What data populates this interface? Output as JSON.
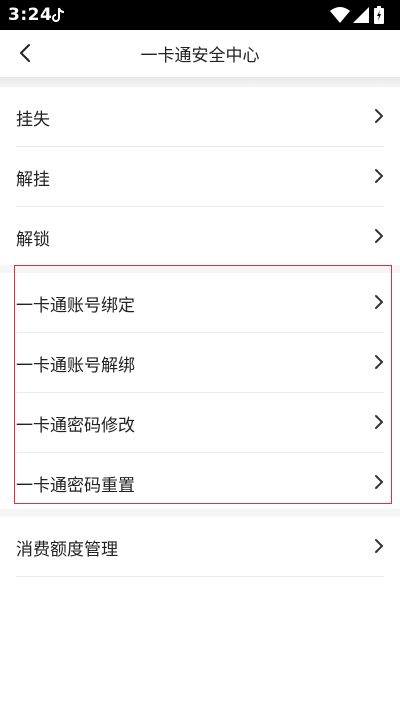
{
  "status_bar": {
    "time": "3:24",
    "icons": [
      "tiktok-icon",
      "wifi-icon",
      "signal-icon",
      "battery-icon"
    ]
  },
  "nav": {
    "title": "一卡通安全中心",
    "back_icon": "chevron-left-icon"
  },
  "sections": [
    {
      "items": [
        {
          "label": "挂失"
        },
        {
          "label": "解挂"
        },
        {
          "label": "解锁"
        }
      ]
    },
    {
      "highlighted": true,
      "highlight_color": "#e5303b",
      "items": [
        {
          "label": "一卡通账号绑定"
        },
        {
          "label": "一卡通账号解绑"
        },
        {
          "label": "一卡通密码修改"
        },
        {
          "label": "一卡通密码重置"
        }
      ]
    },
    {
      "items": [
        {
          "label": "消费额度管理"
        }
      ]
    }
  ],
  "colors": {
    "status_bar_bg": "#000000",
    "separator_bg": "#f5f5f5",
    "text": "#222222",
    "chevron": "#333333"
  }
}
